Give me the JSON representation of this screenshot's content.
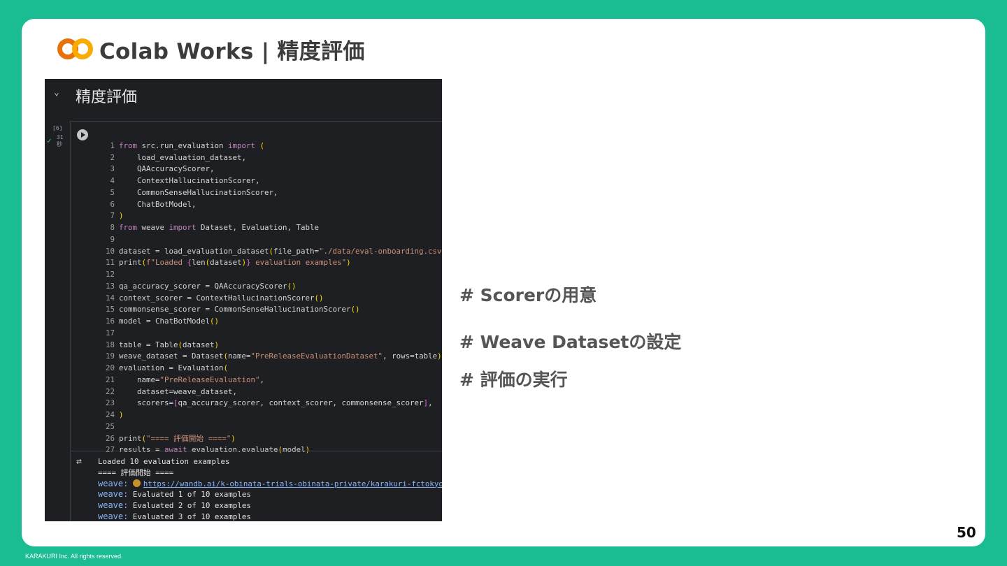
{
  "slide": {
    "title": "Colab Works | 精度評価",
    "page_number": "50",
    "footer": "KARAKURI Inc. All rights reserved."
  },
  "notebook": {
    "section_title": "精度評価",
    "exec_count": "[6]",
    "duration_value": "31",
    "duration_unit": "秒",
    "code_lines": [
      "from src.run_evaluation import (",
      "    load_evaluation_dataset,",
      "    QAAccuracyScorer,",
      "    ContextHallucinationScorer,",
      "    CommonSenseHallucinationScorer,",
      "    ChatBotModel,",
      ")",
      "from weave import Dataset, Evaluation, Table",
      "",
      "dataset = load_evaluation_dataset(file_path=\"./data/eval-onboarding.csv\")",
      "print(f\"Loaded {len(dataset)} evaluation examples\")",
      "",
      "qa_accuracy_scorer = QAAccuracyScorer()",
      "context_scorer = ContextHallucinationScorer()",
      "commonsense_scorer = CommonSenseHallucinationScorer()",
      "model = ChatBotModel()",
      "",
      "table = Table(dataset)",
      "weave_dataset = Dataset(name=\"PreReleaseEvaluationDataset\", rows=table)",
      "evaluation = Evaluation(",
      "    name=\"PreReleaseEvaluation\",",
      "    dataset=weave_dataset,",
      "    scorers=[qa_accuracy_scorer, context_scorer, commonsense_scorer],",
      ")",
      "",
      "print(\"==== 評価開始 ====\")",
      "results = await evaluation.evaluate(model)"
    ],
    "output": {
      "line1": "Loaded 10 evaluation examples",
      "line2": "==== 評価開始 ====",
      "weave_prefix": "weave:",
      "link": "https://wandb.ai/k-obinata-trials-obinata-private/karakuri-fctokyo-cu",
      "evaluated": [
        "Evaluated 1 of 10 examples",
        "Evaluated 2 of 10 examples",
        "Evaluated 3 of 10 examples"
      ]
    }
  },
  "bullets": [
    "# Scorerの用意",
    "# Weave Datasetの設定",
    "# 評価の実行"
  ],
  "colors": {
    "background": "#1abc91",
    "card": "#ffffff",
    "logo_orange": "#f9ab00",
    "logo_dark": "#e8710a"
  }
}
